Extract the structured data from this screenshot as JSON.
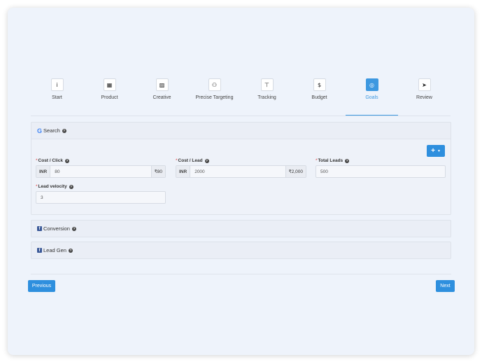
{
  "steps": [
    {
      "label": "Start",
      "icon": "info-icon",
      "glyph": "i"
    },
    {
      "label": "Product",
      "icon": "building-icon",
      "glyph": "▦"
    },
    {
      "label": "Creative",
      "icon": "image-icon",
      "glyph": "▨"
    },
    {
      "label": "Precise Targeting",
      "icon": "users-icon",
      "glyph": "⚇"
    },
    {
      "label": "Tracking",
      "icon": "pin-icon",
      "glyph": "⊤"
    },
    {
      "label": "Budget",
      "icon": "dollar-icon",
      "glyph": "$"
    },
    {
      "label": "Goals",
      "icon": "target-icon",
      "glyph": "◎",
      "active": true
    },
    {
      "label": "Review",
      "icon": "send-icon",
      "glyph": "➤"
    }
  ],
  "search_panel": {
    "title": "Search",
    "brand_glyph": "G",
    "cost_click": {
      "label": "Cost / Click",
      "currency": "INR",
      "value": "80",
      "converted": "₹80"
    },
    "cost_lead": {
      "label": "Cost / Lead",
      "currency": "INR",
      "value": "2000",
      "converted": "₹2,000"
    },
    "total_leads": {
      "label": "Total Leads",
      "value": "500"
    },
    "lead_velocity": {
      "label": "Lead velocity",
      "value": "3"
    },
    "add_glyph": "+",
    "caret_glyph": "▼"
  },
  "conversion_panel": {
    "title": "Conversion",
    "brand_glyph": "f"
  },
  "leadgen_panel": {
    "title": "Lead Gen",
    "brand_glyph": "f"
  },
  "help_glyph": "?",
  "nav": {
    "previous": "Previous",
    "next": "Next"
  },
  "colors": {
    "accent": "#2e8fde",
    "active_step": "#3d98e0",
    "required": "#e04040"
  }
}
